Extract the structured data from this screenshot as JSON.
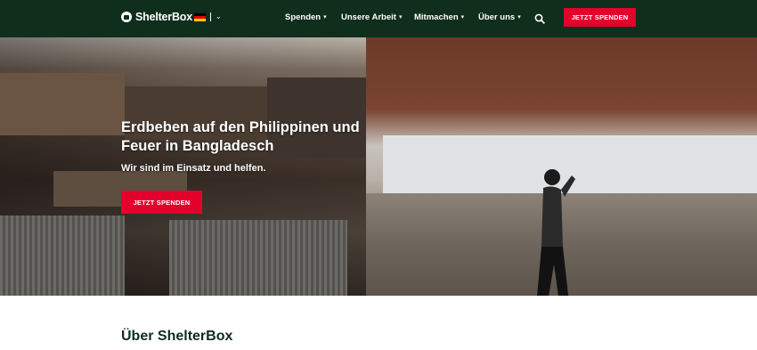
{
  "brand": {
    "name": "ShelterBox"
  },
  "language": {
    "current": "de"
  },
  "nav": {
    "items": [
      {
        "label": "Spenden"
      },
      {
        "label": "Unsere Arbeit"
      },
      {
        "label": "Mitmachen"
      },
      {
        "label": "Über uns"
      }
    ],
    "cta_label": "JETZT SPENDEN"
  },
  "hero": {
    "title": "Erdbeben auf den Philippinen und Feuer in Bangladesch",
    "subtitle": "Wir sind im Einsatz und helfen.",
    "cta_label": "JETZT SPENDEN"
  },
  "about": {
    "title": "Über ShelterBox"
  },
  "colors": {
    "header_bg": "#0f2e1c",
    "accent_red": "#e4002b",
    "heading_green": "#0f2e1c"
  },
  "icons": {
    "logo": "shelterbox-logo-icon",
    "flag": "german-flag-icon",
    "dropdown": "chevron-down-icon",
    "search": "search-icon"
  }
}
